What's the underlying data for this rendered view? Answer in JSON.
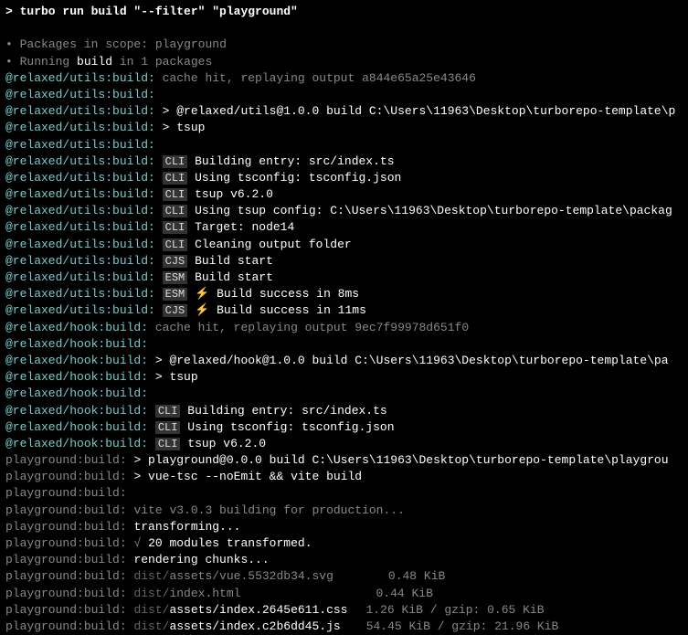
{
  "command": "> turbo run build \"--filter\" \"playground\"",
  "scope": {
    "packages_label": "Packages in scope:",
    "packages_value": "playground",
    "running_prefix": "Running",
    "running_task": "build",
    "running_suffix": "in 1 packages"
  },
  "utils": {
    "prefix": "@relaxed/utils:build:",
    "cache_hit": "cache hit, replaying output",
    "cache_hash": "a844e65a25e43646",
    "pkg_build": "> @relaxed/utils@1.0.0 build C:\\Users\\11963\\Desktop\\turborepo-template\\p",
    "tsup": "> tsup",
    "cli_entry": "Building entry: src/index.ts",
    "cli_tsconfig": "Using tsconfig: tsconfig.json",
    "cli_version": "tsup v6.2.0",
    "cli_config": "Using tsup config: C:\\Users\\11963\\Desktop\\turborepo-template\\packag",
    "cli_target": "Target: node14",
    "cli_clean": "Cleaning output folder",
    "cjs_start": "Build start",
    "esm_start": "Build start",
    "esm_success": "Build success in 8ms",
    "cjs_success": "Build success in 11ms",
    "tag_cli": "CLI",
    "tag_cjs": "CJS",
    "tag_esm": "ESM"
  },
  "hook": {
    "prefix": "@relaxed/hook:build:",
    "cache_hit": "cache hit, replaying output",
    "cache_hash": "9ec7f99978d651f0",
    "pkg_build": "> @relaxed/hook@1.0.0 build C:\\Users\\11963\\Desktop\\turborepo-template\\pa",
    "tsup": "> tsup",
    "cli_entry": "Building entry: src/index.ts",
    "cli_tsconfig": "Using tsconfig: tsconfig.json",
    "cli_version": "tsup v6.2.0",
    "tag_cli": "CLI"
  },
  "playground": {
    "prefix": "playground:build:",
    "pkg_build": "> playground@0.0.0 build C:\\Users\\11963\\Desktop\\turborepo-template\\playgrou",
    "vue_tsc": "> vue-tsc --noEmit && vite build",
    "vite_version": "vite v3.0.3 building for production...",
    "transforming": "transforming...",
    "transformed": "20 modules transformed.",
    "check": "√",
    "rendering": "rendering chunks...",
    "files": [
      {
        "path": "dist/",
        "name": "assets/vue.5532db34.svg",
        "size": "0.48 KiB"
      },
      {
        "path": "dist/",
        "name": "index.html",
        "size": "0.44 KiB"
      },
      {
        "path": "dist/",
        "name": "assets/index.2645e611.css",
        "size": "1.26 KiB / gzip: 0.65 KiB"
      },
      {
        "path": "dist/",
        "name": "assets/index.c2b6dd45.js",
        "size": "54.45 KiB / gzip: 21.96 KiB"
      }
    ]
  }
}
